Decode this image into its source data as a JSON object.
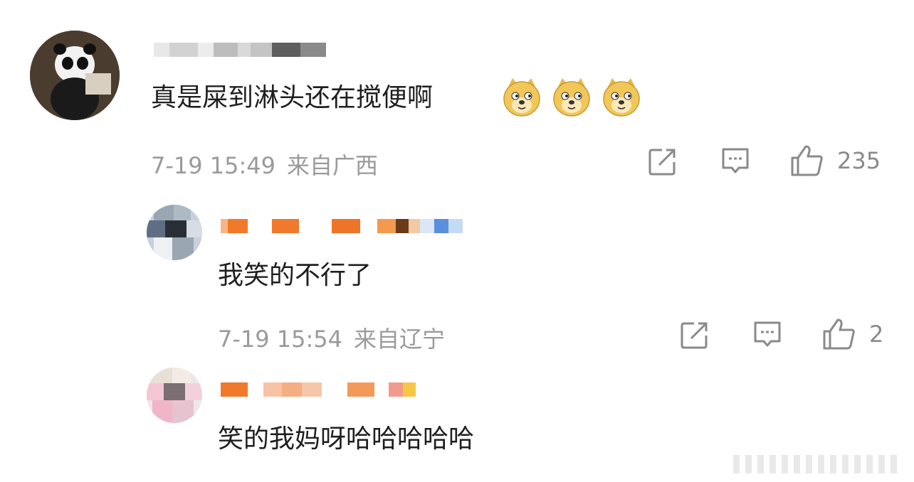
{
  "comments": [
    {
      "text": "真是屎到淋头还在搅便啊",
      "emoji_icon": "doge-emoji-icon",
      "emoji_count": 3,
      "date": "7-19 15:49",
      "location": "来自广西",
      "like_count": "235"
    },
    {
      "text": "我笑的不行了",
      "date": "7-19 15:54",
      "location": "来自辽宁",
      "like_count": "2"
    },
    {
      "text": "笑的我妈呀哈哈哈哈哈"
    }
  ],
  "icons": {
    "share": "share-icon",
    "comment": "comment-icon",
    "like": "thumbs-up-icon"
  },
  "colors": {
    "text": "#1f1f1f",
    "meta": "#9a9a9a",
    "orange_username": "#f07a2a"
  }
}
